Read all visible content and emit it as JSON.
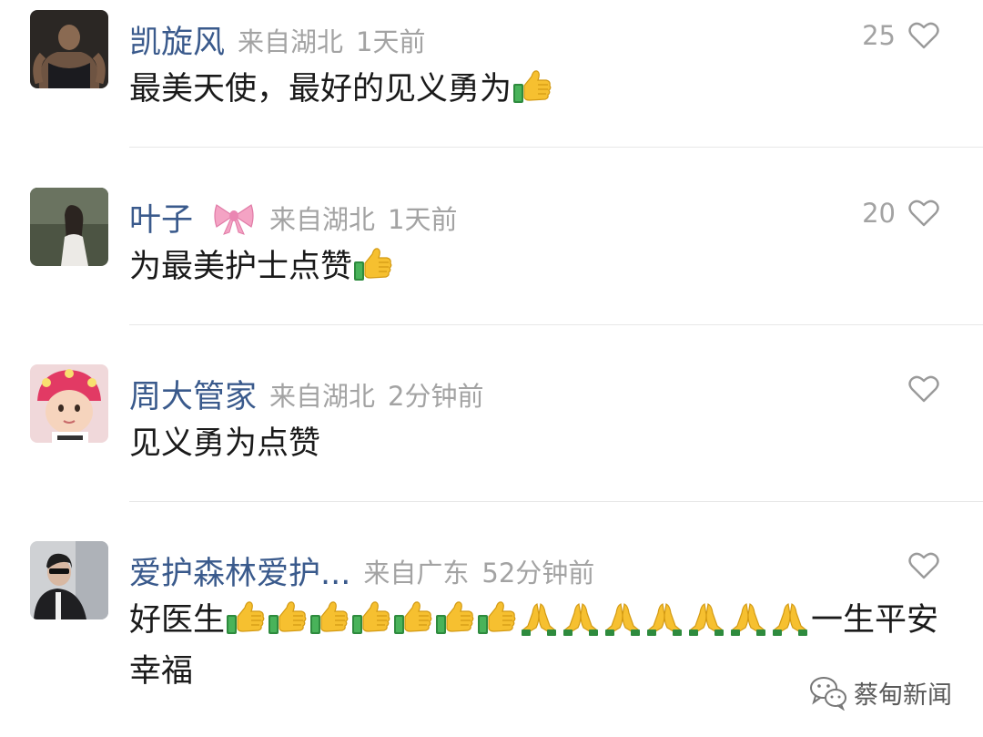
{
  "comments": [
    {
      "username": "凯旋风",
      "location": "来自湖北",
      "time": "1天前",
      "like_count": "25",
      "text": "最美天使，最好的见义勇为",
      "emoji_after": [
        "thumbs-up"
      ]
    },
    {
      "username": "叶子",
      "badge": "bow-icon",
      "location": "来自湖北",
      "time": "1天前",
      "like_count": "20",
      "text": "为最美护士点赞",
      "emoji_after": [
        "thumbs-up"
      ]
    },
    {
      "username": "周大管家",
      "location": "来自湖北",
      "time": "2分钟前",
      "like_count": "",
      "text": "见义勇为点赞",
      "emoji_after": []
    },
    {
      "username": "爱护森林爱护...",
      "location": "来自广东",
      "time": "52分钟前",
      "like_count": "",
      "text_before": "好医生",
      "text_after": "一生平安幸福",
      "emoji_middle": [
        "thumbs-up",
        "thumbs-up",
        "thumbs-up",
        "thumbs-up",
        "thumbs-up",
        "thumbs-up",
        "thumbs-up",
        "folded-hands",
        "folded-hands",
        "folded-hands",
        "folded-hands",
        "folded-hands",
        "folded-hands",
        "folded-hands"
      ]
    }
  ],
  "watermark": {
    "text": "蔡甸新闻",
    "icon": "wechat-icon"
  },
  "colors": {
    "username": "#3a5a8c",
    "meta": "#a3a3a3",
    "body_text": "#1a1a1a",
    "divider": "#e8e8e8"
  }
}
